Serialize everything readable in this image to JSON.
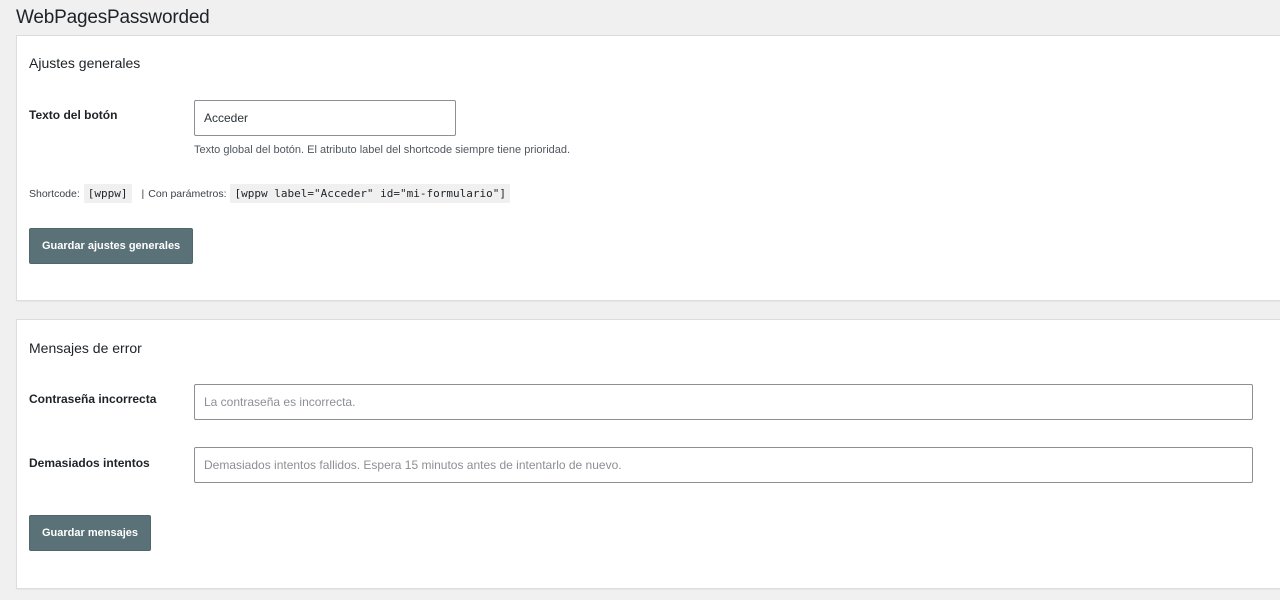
{
  "page": {
    "title": "WebPagesPassworded"
  },
  "general": {
    "title": "Ajustes generales",
    "button_text_label": "Texto del botón",
    "button_text_value": "Acceder",
    "button_text_description": "Texto global del botón. El atributo label del shortcode siempre tiene prioridad.",
    "shortcode_label": "Shortcode:",
    "shortcode_code": "[wppw]",
    "separator": "|",
    "params_label": "Con parámetros:",
    "params_code": "[wppw label=\"Acceder\" id=\"mi-formulario\"]",
    "save_label": "Guardar ajustes generales"
  },
  "errors": {
    "title": "Mensajes de error",
    "wrong_password_label": "Contraseña incorrecta",
    "wrong_password_placeholder": "La contraseña es incorrecta.",
    "too_many_label": "Demasiados intentos",
    "too_many_placeholder": "Demasiados intentos fallidos. Espera 15 minutos antes de intentarlo de nuevo.",
    "save_label": "Guardar mensajes"
  },
  "colors": {
    "background": "#f0f0f1",
    "card": "#ffffff",
    "button": "#5a7177"
  }
}
